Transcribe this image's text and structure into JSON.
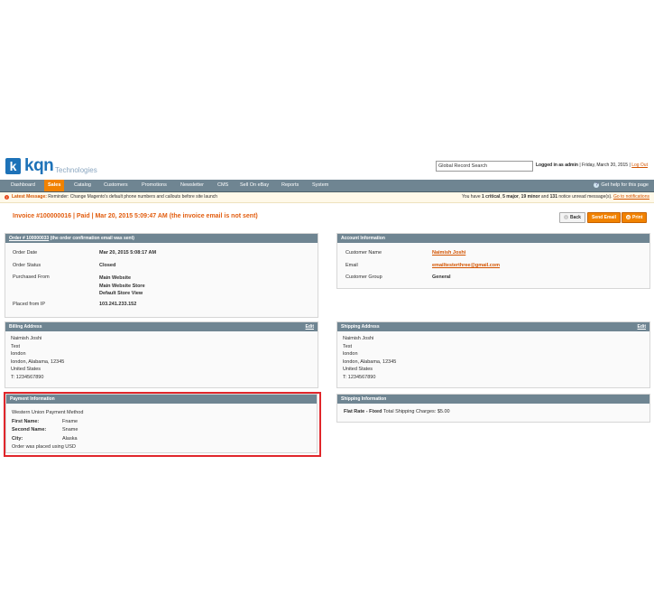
{
  "header": {
    "logo_letter": "k",
    "logo_text": "kqn",
    "logo_sub": "Technologies",
    "search_value": "Global Record Search",
    "login_text": "Logged in as admin",
    "date_text": "Friday, March 20, 2015",
    "logout": "Log Out"
  },
  "nav": {
    "items": [
      "Dashboard",
      "Sales",
      "Catalog",
      "Customers",
      "Promotions",
      "Newsletter",
      "CMS",
      "Sell On eBay",
      "Reports",
      "System"
    ],
    "active": "Sales",
    "help": "Get help for this page"
  },
  "notice": {
    "label": "Latest Message:",
    "text": "Reminder: Change Magento's default phone numbers and callouts before site launch",
    "right_prefix": "You have",
    "critical": "1 critical",
    "major": "5 major",
    "minor": "19 minor",
    "notice_ct": "131",
    "right_suffix": "notice unread message(s).",
    "link": "Go to notifications"
  },
  "page": {
    "title": "Invoice #100000016 | Paid | Mar 20, 2015 5:09:47 AM (the invoice email is not sent)",
    "back_btn": "Back",
    "email_btn": "Send Email",
    "print_btn": "Print"
  },
  "order_box": {
    "title_link": "Order # 100000033",
    "title_rest": "(the order confirmation email was sent)",
    "order_date_label": "Order Date",
    "order_date": "Mar 20, 2015 5:08:17 AM",
    "status_label": "Order Status",
    "status": "Closed",
    "purchased_label": "Purchased From",
    "purchased": [
      "Main Website",
      "Main Website Store",
      "Default Store View"
    ],
    "ip_label": "Placed from IP",
    "ip": "103.241.233.152"
  },
  "account_box": {
    "title": "Account Information",
    "name_label": "Customer Name",
    "name": "Naimish Joshi",
    "email_label": "Email",
    "email": "emailtesterthree@gmail.com",
    "group_label": "Customer Group",
    "group": "General"
  },
  "billing": {
    "title": "Billing Address",
    "edit": "Edit",
    "lines": [
      "Naimish Joshi",
      "Test",
      "london",
      "london, Alabama, 12345",
      "United States",
      "T: 1234567890"
    ]
  },
  "shipping": {
    "title": "Shipping Address",
    "edit": "Edit",
    "lines": [
      "Naimish Joshi",
      "Test",
      "london",
      "london, Alabama, 12345",
      "United States",
      "T: 1234567890"
    ]
  },
  "payment": {
    "title": "Payment Information",
    "method": "Western Union Payment Method",
    "first_label": "First Name:",
    "first": "Fname",
    "second_label": "Second Name:",
    "second": "Sname",
    "city_label": "City:",
    "city": "Alaska",
    "currency": "Order was placed using USD"
  },
  "shipping_info": {
    "title": "Shipping Information",
    "rate_bold": "Flat Rate - Fixed",
    "rate_text": "Total Shipping Charges: $5.00"
  },
  "colors": {
    "accent": "#f18200",
    "nav": "#6f8592",
    "title": "#e25d0f",
    "highlight": "#e0262b"
  }
}
